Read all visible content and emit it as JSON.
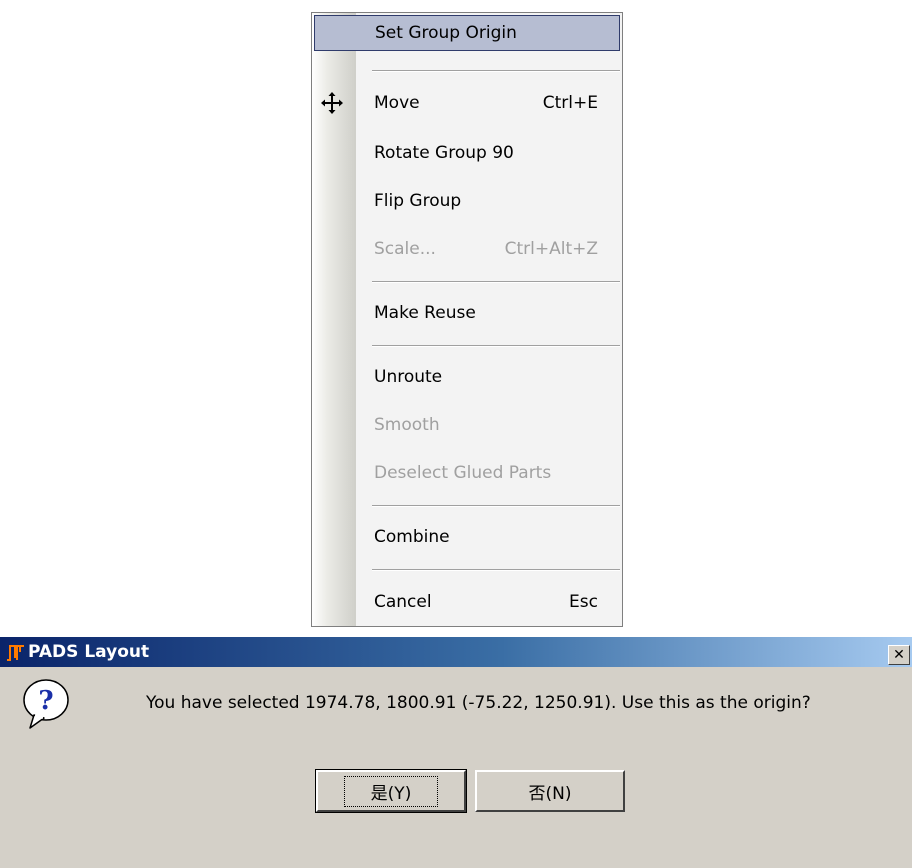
{
  "menu": {
    "items": [
      {
        "label": "Set Group Origin",
        "shortcut": "",
        "disabled": false,
        "highlighted": true
      },
      {
        "label": "Move",
        "shortcut": "Ctrl+E",
        "disabled": false,
        "icon": "move-arrows-icon"
      },
      {
        "label": "Rotate Group 90",
        "shortcut": "",
        "disabled": false
      },
      {
        "label": "Flip Group",
        "shortcut": "",
        "disabled": false
      },
      {
        "label": "Scale...",
        "shortcut": "Ctrl+Alt+Z",
        "disabled": true
      },
      {
        "label": "Make Reuse",
        "shortcut": "",
        "disabled": false
      },
      {
        "label": "Unroute",
        "shortcut": "",
        "disabled": false
      },
      {
        "label": "Smooth",
        "shortcut": "",
        "disabled": true
      },
      {
        "label": "Deselect Glued Parts",
        "shortcut": "",
        "disabled": true
      },
      {
        "label": "Combine",
        "shortcut": "",
        "disabled": false
      },
      {
        "label": "Cancel",
        "shortcut": "Esc",
        "disabled": false
      }
    ]
  },
  "dialog": {
    "title": "PADS Layout",
    "close_glyph": "✕",
    "message": "You have selected 1974.78, 1800.91 (-75.22, 1250.91).  Use this as the origin?",
    "icon": "question-icon",
    "yes_label": "是(Y)",
    "no_label": "否(N)"
  },
  "colors": {
    "highlight": "#b6bdd2",
    "titlebar_start": "#0a246a",
    "titlebar_end": "#a6caf0",
    "dialog_bg": "#d4d0c8"
  }
}
